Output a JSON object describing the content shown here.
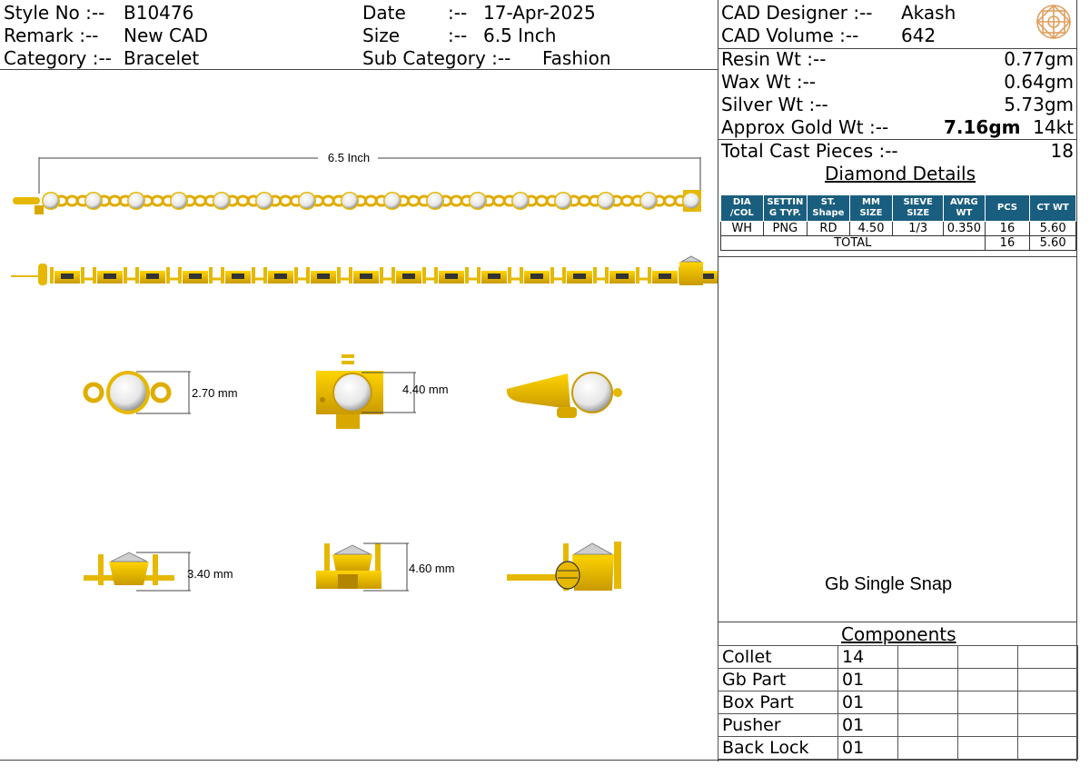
{
  "header": {
    "style_no_label": "Style No :--",
    "style_no": "B10476",
    "remark_label": "Remark :--",
    "remark": "New CAD",
    "category_label": "Category :--",
    "category": "Bracelet",
    "date_label": "Date",
    "date_sep": ":--",
    "date": "17-Apr-2025",
    "size_label": "Size",
    "size_sep": ":--",
    "size": "6.5 Inch",
    "subcat_label": "Sub Category :--",
    "subcat": "Fashion"
  },
  "cad": {
    "designer_label": "CAD   Designer :--",
    "designer": "Akash",
    "volume_label": "CAD    Volume  :--",
    "volume": "642"
  },
  "weights": {
    "resin_label": "Resin Wt :--",
    "resin": "0.77gm",
    "wax_label": "Wax  Wt :--",
    "wax": "0.64gm",
    "silver_label": "Silver Wt :--",
    "silver": "5.73gm",
    "gold_label": "Approx Gold Wt :--",
    "gold": "7.16gm",
    "gold_karat": "14kt",
    "cast_label": "Total Cast Pieces :--",
    "cast": "18"
  },
  "diamond": {
    "title": "Diamond Details",
    "headers": [
      "DIA /COL",
      "SETTIN G TYP.",
      "ST. Shape",
      "MM SIZE",
      "SIEVE SIZE",
      "AVRG WT",
      "PCS",
      "CT WT"
    ],
    "row": [
      "WH",
      "PNG",
      "RD",
      "4.50",
      "1/3",
      "0.350",
      "16",
      "5.60"
    ],
    "total_label": "TOTAL",
    "total_pcs": "16",
    "total_ct": "5.60"
  },
  "drawing": {
    "length_label": "6.5 Inch",
    "dim_collet_width": "2.70 mm",
    "dim_clasp_width": "4.40 mm",
    "dim_collet_height": "3.40 mm",
    "dim_clasp_height": "4.60 mm"
  },
  "lock_name": "Gb Single Snap",
  "components": {
    "title": "Components",
    "items": [
      {
        "name": "Collet",
        "qty": "14"
      },
      {
        "name": "Gb Part",
        "qty": "01"
      },
      {
        "name": "Box Part",
        "qty": "01"
      },
      {
        "name": "Pusher",
        "qty": "01"
      },
      {
        "name": "Back Lock",
        "qty": "01"
      }
    ]
  },
  "colors": {
    "gold": "#e6b800",
    "table_header": "#1a5e7f"
  }
}
